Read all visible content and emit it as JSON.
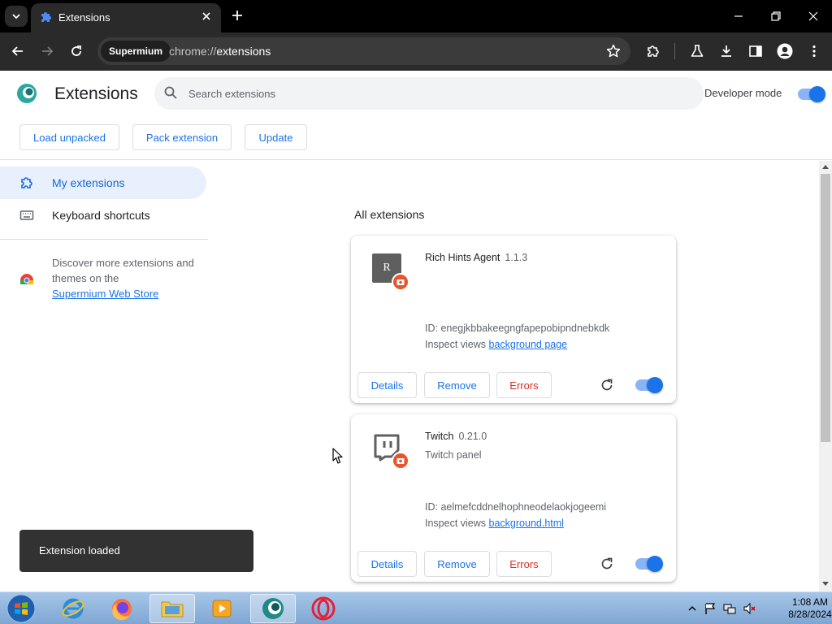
{
  "browser": {
    "tab_title": "Extensions",
    "omnibox_chip": "Supermium",
    "url_scheme": "chrome://",
    "url_host": "extensions"
  },
  "header": {
    "title": "Extensions",
    "search_placeholder": "Search extensions",
    "developer_mode_label": "Developer mode",
    "developer_mode_on": true
  },
  "dev_toolbar": {
    "load_unpacked": "Load unpacked",
    "pack_extension": "Pack extension",
    "update": "Update"
  },
  "sidebar": {
    "items": [
      {
        "label": "My extensions",
        "icon": "puzzle-icon",
        "active": true
      },
      {
        "label": "Keyboard shortcuts",
        "icon": "keyboard-icon",
        "active": false
      }
    ],
    "store_text": "Discover more extensions and themes on the",
    "store_link": "Supermium Web Store"
  },
  "main": {
    "section_title": "All extensions",
    "inspect_views_label": "Inspect views",
    "extensions": [
      {
        "name": "Rich Hints Agent",
        "version": "1.1.3",
        "description": "",
        "id_text": "ID: enegjkbbakeegngfapepobipndnebkdk",
        "inspect_link": "background page",
        "icon_letter": "R",
        "enabled": true
      },
      {
        "name": "Twitch",
        "version": "0.21.0",
        "description": "Twitch panel",
        "id_text": "ID: aelmefcddnelhophneodelaokjogeemi",
        "inspect_link": "background.html",
        "icon_letter": "",
        "enabled": true
      }
    ],
    "buttons": {
      "details": "Details",
      "remove": "Remove",
      "errors": "Errors"
    }
  },
  "toast": {
    "message": "Extension loaded"
  },
  "taskbar": {
    "time": "1:08 AM",
    "date": "8/28/2024"
  },
  "colors": {
    "accent": "#1a73e8",
    "error": "#d93025",
    "badge": "#e8542d",
    "titlebar": "#000000",
    "toolbar": "#2a2a2a"
  }
}
